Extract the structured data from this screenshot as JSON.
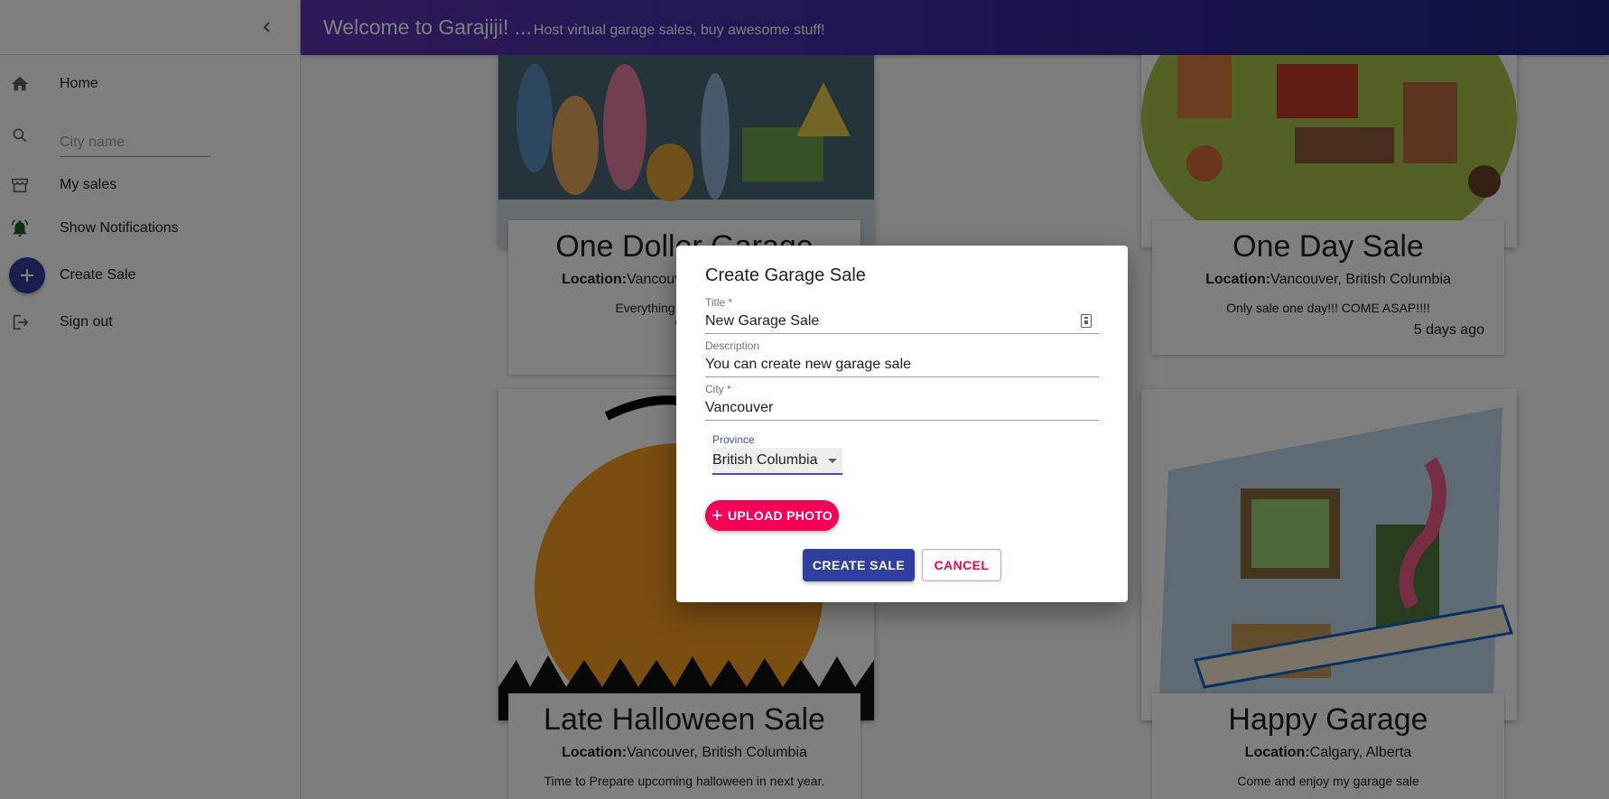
{
  "header": {
    "title": "Welcome to Garajiji! ...",
    "subtitle": "Host virtual garage sales, buy awesome stuff!"
  },
  "sidebar": {
    "collapse_icon": "chevron-left-icon",
    "items": [
      {
        "label": "Home",
        "icon": "home-icon"
      },
      {
        "label": "My sales",
        "icon": "store-icon"
      },
      {
        "label": "Show Notifications",
        "icon": "bell-icon"
      },
      {
        "label": "Create Sale",
        "icon": "plus-icon"
      },
      {
        "label": "Sign out",
        "icon": "sign-out-icon"
      }
    ],
    "search": {
      "placeholder": "City name",
      "icon": "search-icon"
    }
  },
  "sales": [
    {
      "title": "One Doller Garage",
      "location_label": "Location:",
      "location": "Vancouver, British Columbia",
      "description_line1": "Everything is $1!!! VERY",
      "description_line2": "CO",
      "date": ""
    },
    {
      "title": "One Day Sale",
      "location_label": "Location:",
      "location": "Vancouver, British Columbia",
      "description": "Only sale one day!!! COME ASAP!!!!",
      "date": "5 days ago"
    },
    {
      "title": "Late Halloween Sale",
      "location_label": "Location:",
      "location": "Vancouver, British Columbia",
      "description": "Time to Prepare upcoming halloween in next year."
    },
    {
      "title": "Happy Garage",
      "location_label": "Location:",
      "location": "Calgary, Alberta",
      "description": "Come and enjoy my garage sale"
    }
  ],
  "dialog": {
    "title": "Create Garage Sale",
    "fields": {
      "title": {
        "label": "Title *",
        "value": "New Garage Sale"
      },
      "description": {
        "label": "Description",
        "value": "You can create new garage sale"
      },
      "city": {
        "label": "City *",
        "value": "Vancouver"
      },
      "province": {
        "label": "Province",
        "value": "British Columbia"
      }
    },
    "upload_label": "UPLOAD PHOTO",
    "create_label": "CREATE SALE",
    "cancel_label": "CANCEL"
  },
  "colors": {
    "primary": "#303f9f",
    "accent": "#f50057",
    "notification": "#1b5e20"
  }
}
